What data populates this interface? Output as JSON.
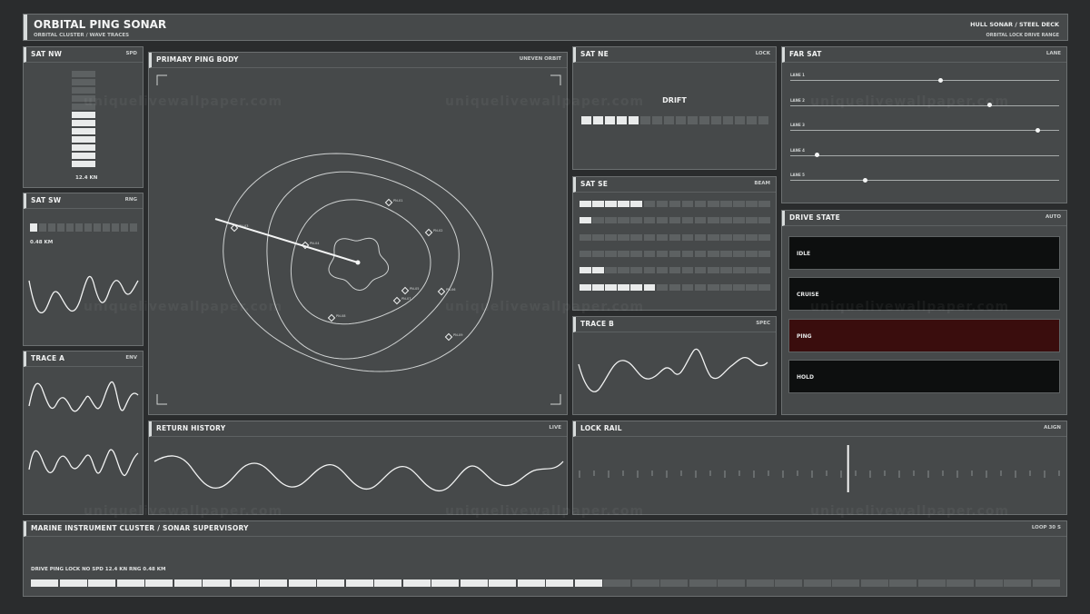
{
  "header": {
    "title": "ORBITAL PING SONAR",
    "subtitle": "ORBITAL CLUSTER / WAVE TRACES",
    "right_title": "HULL SONAR / STEEL DECK",
    "right_sub": "ORBITAL LOCK  DRIVE  RANGE"
  },
  "sat_nw": {
    "title": "SAT NW",
    "tag": "SPD",
    "value": "12.4 KN",
    "level_fraction": 0.55
  },
  "sat_sw": {
    "title": "SAT SW",
    "tag": "RNG",
    "value": "0.48 KM",
    "level_fraction": 0.08
  },
  "trace_a": {
    "title": "TRACE A",
    "tag": "ENV"
  },
  "primary": {
    "title": "PRIMARY  PING BODY",
    "tag": "UNEVEN ORBIT",
    "pings": [
      {
        "label": "PN-01"
      },
      {
        "label": "PN-02"
      },
      {
        "label": "PN-03"
      },
      {
        "label": "PN-04"
      },
      {
        "label": "PN-05"
      },
      {
        "label": "PN-06"
      },
      {
        "label": "PN-07"
      },
      {
        "label": "PN-08"
      },
      {
        "label": "PN-09"
      }
    ]
  },
  "sat_ne": {
    "title": "SAT NE",
    "tag": "LOCK",
    "label": "DRIFT",
    "level_fraction": 0.32
  },
  "sat_se": {
    "title": "SAT SE",
    "tag": "BEAM",
    "rows": [
      0.33,
      0.07,
      0.0,
      0.0,
      0.14,
      0.4
    ]
  },
  "trace_b": {
    "title": "TRACE B",
    "tag": "SPEC"
  },
  "far_sat": {
    "title": "FAR SAT",
    "tag": "LANE",
    "lanes": [
      {
        "label": "LANE 1",
        "value": 0.56
      },
      {
        "label": "LANE 2",
        "value": 0.74
      },
      {
        "label": "LANE 3",
        "value": 0.92
      },
      {
        "label": "LANE 4",
        "value": 0.1
      },
      {
        "label": "LANE 5",
        "value": 0.28
      }
    ]
  },
  "drive_state": {
    "title": "DRIVE STATE",
    "tag": "AUTO",
    "options": [
      "IDLE",
      "CRUISE",
      "PING",
      "HOLD"
    ],
    "active": "PING"
  },
  "return_history": {
    "title": "RETURN HISTORY",
    "tag": "LIVE"
  },
  "lock_rail": {
    "title": "LOCK RAIL",
    "tag": "ALIGN",
    "position_fraction": 0.56
  },
  "footer": {
    "title": "MARINE INSTRUMENT CLUSTER  /  SONAR SUPERVISORY",
    "tag": "LOOP 30 S",
    "status": "DRIVE PING   LOCK NO   SPD 12.4 KN   RNG 0.48 KM",
    "progress_fraction": 0.55
  },
  "watermark": "uniquelivewallpaper.com",
  "colors": {
    "accent": "#e6e8e8",
    "panel": "#46494a",
    "active": "#3a0d0d",
    "bg": "#2a2c2d"
  }
}
